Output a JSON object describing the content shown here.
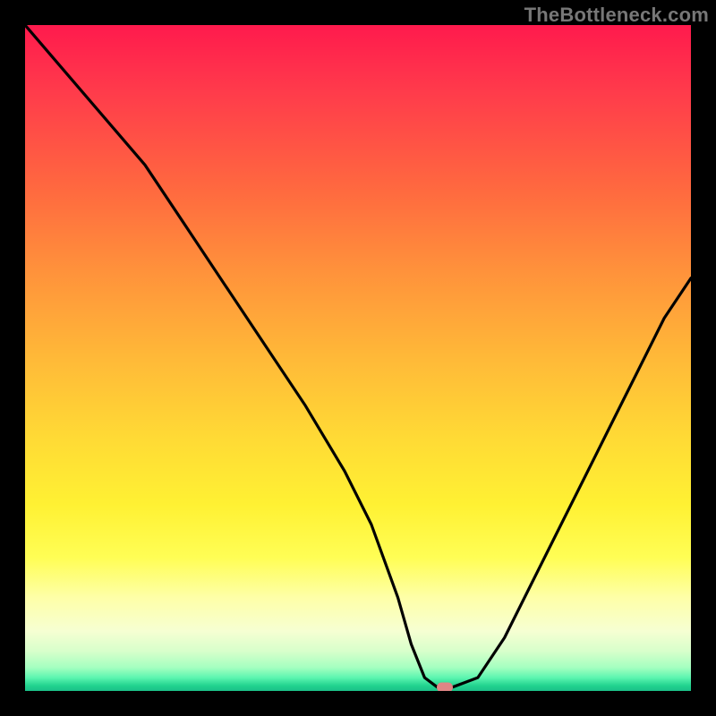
{
  "watermark": "TheBottleneck.com",
  "chart_data": {
    "type": "line",
    "title": "",
    "xlabel": "",
    "ylabel": "",
    "xlim": [
      0,
      100
    ],
    "ylim": [
      0,
      100
    ],
    "grid": false,
    "legend": false,
    "background_gradient": {
      "top": "#ff1a4d",
      "bottom": "#1bc088",
      "note": "red (top) to green (bottom) smooth gradient via orange/yellow"
    },
    "series": [
      {
        "name": "bottleneck-curve",
        "color": "#000000",
        "x": [
          0,
          6,
          12,
          18,
          24,
          30,
          36,
          42,
          48,
          52,
          56,
          58,
          60,
          62,
          64,
          68,
          72,
          76,
          80,
          84,
          88,
          92,
          96,
          100
        ],
        "y": [
          100,
          93,
          86,
          79,
          70,
          61,
          52,
          43,
          33,
          25,
          14,
          7,
          2,
          0.5,
          0.5,
          2,
          8,
          16,
          24,
          32,
          40,
          48,
          56,
          62
        ]
      }
    ],
    "marker": {
      "name": "minimum-indicator",
      "color": "#e08585",
      "x": 63,
      "y": 0.5
    }
  }
}
